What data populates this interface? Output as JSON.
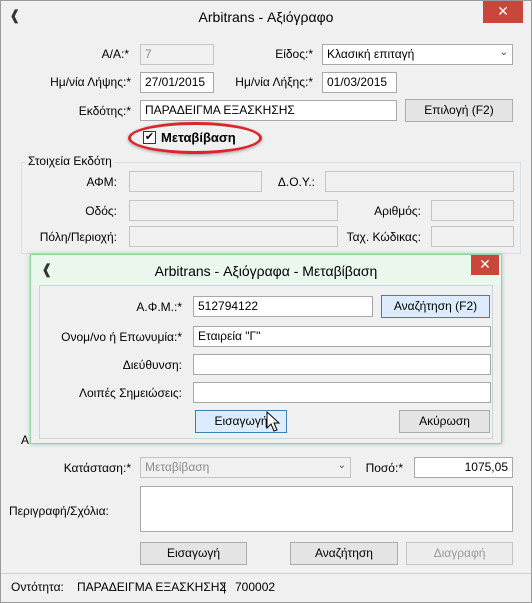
{
  "window": {
    "title": "Arbitrans - Αξιόγραφο"
  },
  "form": {
    "aa_label": "Α/Α:*",
    "aa_value": "7",
    "type_label": "Είδος:*",
    "type_value": "Κλασική επιταγή",
    "receive_label": "Ημ/νία Λήψης:*",
    "receive_value": "27/01/2015",
    "expiry_label": "Ημ/νία Λήξης:*",
    "expiry_value": "01/03/2015",
    "issuer_label": "Εκδότης:*",
    "issuer_value": "ΠΑΡΑΔΕΙΓΜΑ ΕΞΑΣΚΗΣΗΣ",
    "select_button": "Επιλογή (F2)",
    "transfer_checkbox": "Μεταβίβαση",
    "transfer_checked": true,
    "issuer_group_title": "Στοιχεία Εκδότη",
    "afm_label": "ΑΦΜ:",
    "doy_label": "Δ.Ο.Υ.:",
    "street_label": "Οδός:",
    "number_label": "Αριθμός:",
    "city_label": "Πόλη/Περιοχή:",
    "zip_label": "Ταχ. Κώδικας:",
    "partial_label_1": "Α",
    "status_label": "Κατάσταση:*",
    "status_value": "Μεταβίβαση",
    "amount_label": "Ποσό:*",
    "amount_value": "1075,05",
    "comments_label": "Περιγραφή/Σχόλια:",
    "insert_button": "Εισαγωγή",
    "search_button": "Αναζήτηση",
    "delete_button": "Διαγραφή"
  },
  "dialog": {
    "title": "Arbitrans - Αξιόγραφα - Μεταβίβαση",
    "afm_label": "Α.Φ.Μ.:*",
    "afm_value": "512794122",
    "search_button": "Αναζήτηση (F2)",
    "name_label": "Ονομ/νο ή Επωνυμία:*",
    "name_value": "Εταιρεία \"Γ\"",
    "address_label": "Διεύθυνση:",
    "address_value": "",
    "notes_label": "Λοιπές Σημειώσεις:",
    "notes_value": "",
    "insert_button": "Εισαγωγή",
    "cancel_button": "Ακύρωση"
  },
  "statusbar": {
    "entity_label": "Οντότητα:",
    "entity_name": "ΠΑΡΑΔΕΙΓΜΑ ΕΞΑΣΚΗΣΗΣ",
    "separator": "|",
    "entity_code": "700002"
  },
  "colors": {
    "close_red": "#c8463a",
    "highlight_oval": "#d8262d",
    "dialog_border": "#8fd3a0"
  }
}
